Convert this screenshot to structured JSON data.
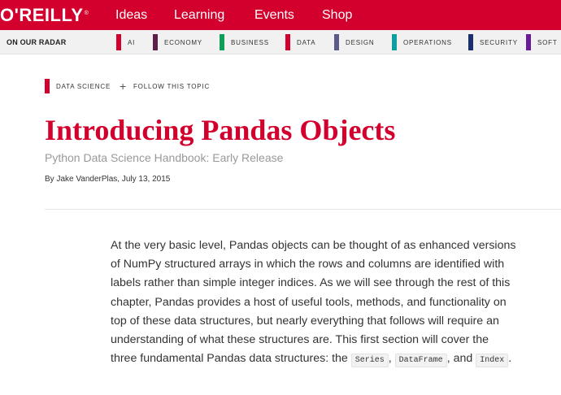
{
  "header": {
    "logo": "O'REILLY",
    "logo_mark": "®",
    "nav": [
      "Ideas",
      "Learning",
      "Events",
      "Shop"
    ]
  },
  "radar": {
    "label": "ON OUR RADAR",
    "topics": [
      {
        "label": "AI",
        "color": "#d3002d"
      },
      {
        "label": "ECONOMY",
        "color": "#5b1f4a"
      },
      {
        "label": "BUSINESS",
        "color": "#0f9d58"
      },
      {
        "label": "DATA",
        "color": "#d3002d"
      },
      {
        "label": "DESIGN",
        "color": "#5a5a8a"
      },
      {
        "label": "OPERATIONS",
        "color": "#0d9ea0"
      },
      {
        "label": "SECURITY",
        "color": "#1a2f6b"
      },
      {
        "label": "SOFT",
        "color": "#6a1b9a"
      }
    ]
  },
  "article": {
    "tag": "DATA SCIENCE",
    "tag_color": "#d3002d",
    "follow": "FOLLOW THIS TOPIC",
    "title": "Introducing Pandas Objects",
    "subtitle": "Python Data Science Handbook: Early Release",
    "byline": "By Jake VanderPlas, July 13, 2015",
    "body_main": "At the very basic level, Pandas objects can be thought of as enhanced versions of NumPy structured arrays in which the rows and columns are identified with labels rather than simple integer indices. As we will see through the rest of this chapter, Pandas provides a host of useful tools, methods, and functionality on top of these data structures, but nearly everything that follows will require an understanding of what these structures are. This first section will cover the three fundamental Pandas data structures: the ",
    "code_series": "Series",
    "sep1": ", ",
    "code_dataframe": "DataFrame",
    "sep2": ", and ",
    "code_index": "Index",
    "end": "."
  }
}
